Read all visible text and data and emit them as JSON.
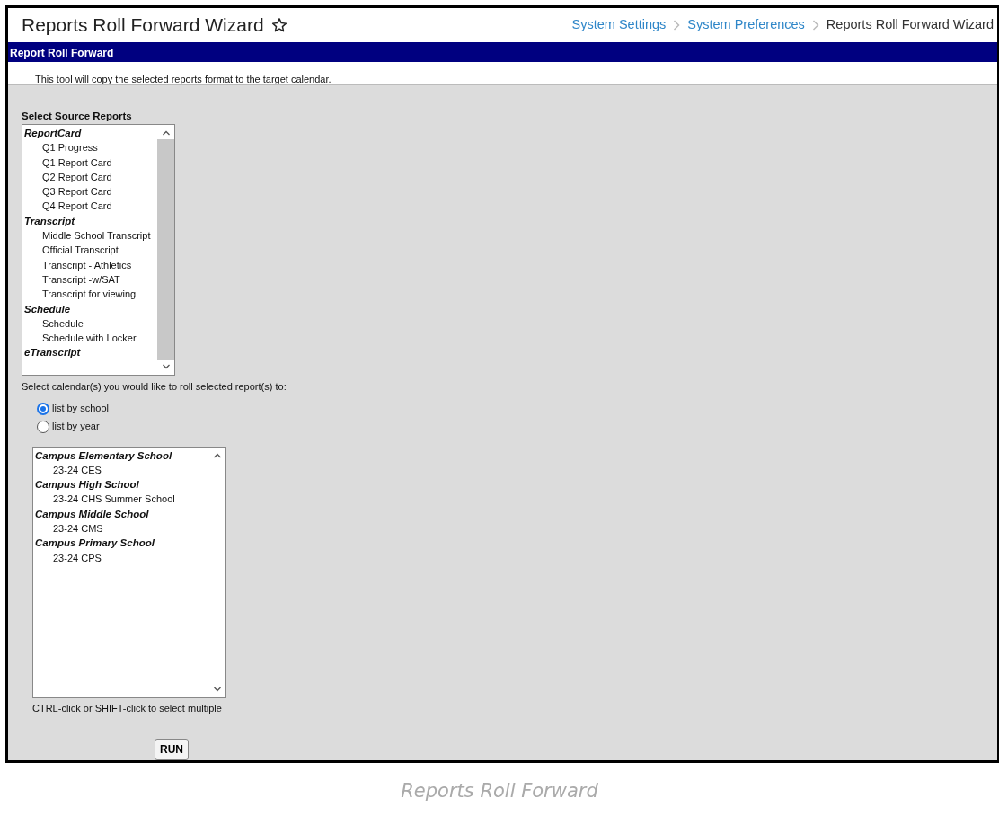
{
  "page": {
    "title": "Reports Roll Forward Wizard",
    "breadcrumbs": [
      {
        "label": "System Settings",
        "kind": "link"
      },
      {
        "label": "System Preferences",
        "kind": "link"
      },
      {
        "label": "Reports Roll Forward Wizard",
        "kind": "current"
      }
    ]
  },
  "panel": {
    "title": "Report Roll Forward",
    "description": "This tool will copy the selected reports format to the target calendar."
  },
  "source_reports": {
    "label": "Select Source Reports",
    "groups": [
      {
        "label": "ReportCard",
        "children": [
          {
            "label": "Q1 Progress"
          },
          {
            "label": "Q1 Report Card"
          },
          {
            "label": "Q2 Report Card"
          },
          {
            "label": "Q3 Report Card"
          },
          {
            "label": "Q4 Report Card"
          }
        ]
      },
      {
        "label": "Transcript",
        "children": [
          {
            "label": "Middle School Transcript"
          },
          {
            "label": "Official Transcript"
          },
          {
            "label": "Transcript - Athletics"
          },
          {
            "label": "Transcript -w/SAT"
          },
          {
            "label": "Transcript for viewing"
          }
        ]
      },
      {
        "label": "Schedule",
        "children": [
          {
            "label": "Schedule"
          },
          {
            "label": "Schedule with Locker"
          }
        ]
      },
      {
        "label": "eTranscript"
      }
    ]
  },
  "calendar_prompt": "Select calendar(s) you would like to roll selected report(s) to:",
  "list_options": [
    {
      "label": "list by school",
      "selected": true
    },
    {
      "label": "list by year",
      "selected": false
    }
  ],
  "calendars": {
    "groups": [
      {
        "label": "Campus Elementary School",
        "children": [
          {
            "label": "23-24 CES"
          }
        ]
      },
      {
        "label": "Campus High School",
        "children": [
          {
            "label": "23-24 CHS Summer School"
          }
        ]
      },
      {
        "label": "Campus Middle School",
        "children": [
          {
            "label": "23-24 CMS"
          }
        ]
      },
      {
        "label": "Campus Primary School",
        "children": [
          {
            "label": "23-24 CPS"
          }
        ]
      }
    ],
    "hint": "CTRL-click or SHIFT-click to select multiple"
  },
  "run_button": "RUN",
  "caption": "Reports Roll Forward"
}
